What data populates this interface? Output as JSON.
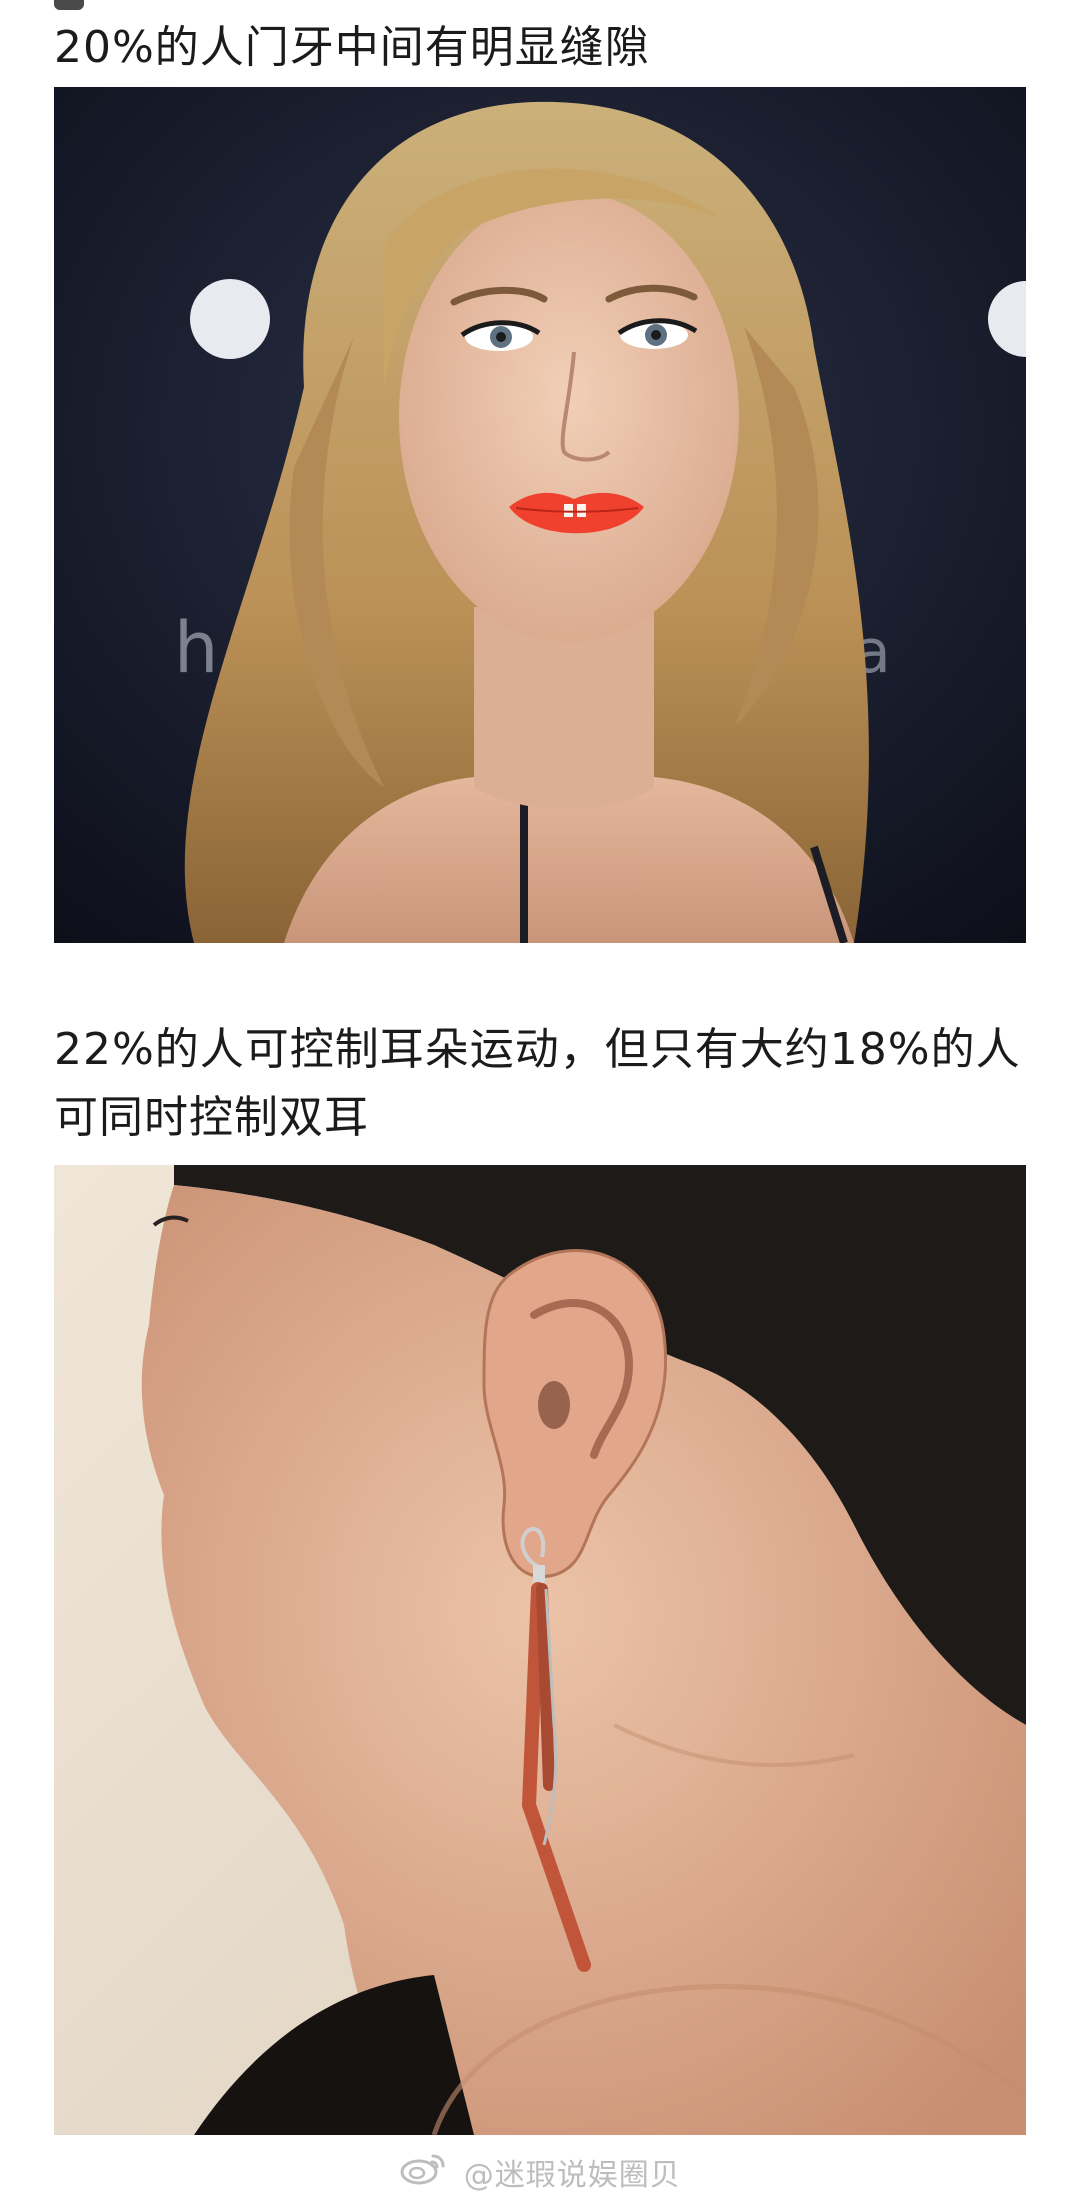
{
  "facts": [
    {
      "caption": "20%的人门牙中间有明显缝隙",
      "image_alt": "woman-with-gap-teeth-photo"
    },
    {
      "caption": "22%的人可控制耳朵运动，但只有大约18%的人可同时控制双耳",
      "image_alt": "ear-closeup-photo"
    }
  ],
  "watermark": {
    "text": "@迷瑕说娱圈贝"
  },
  "colors": {
    "text": "#1b1b1b",
    "photo1_bg": "#16192a",
    "photo2_bg": "#e8dccb",
    "lip": "#f0412e",
    "hair_blonde": "#c9a467",
    "hair_dark": "#1e1a18",
    "skin": "#e6b59a",
    "earring": "#c0553a"
  },
  "icons": [
    "weibo-logo-icon"
  ]
}
